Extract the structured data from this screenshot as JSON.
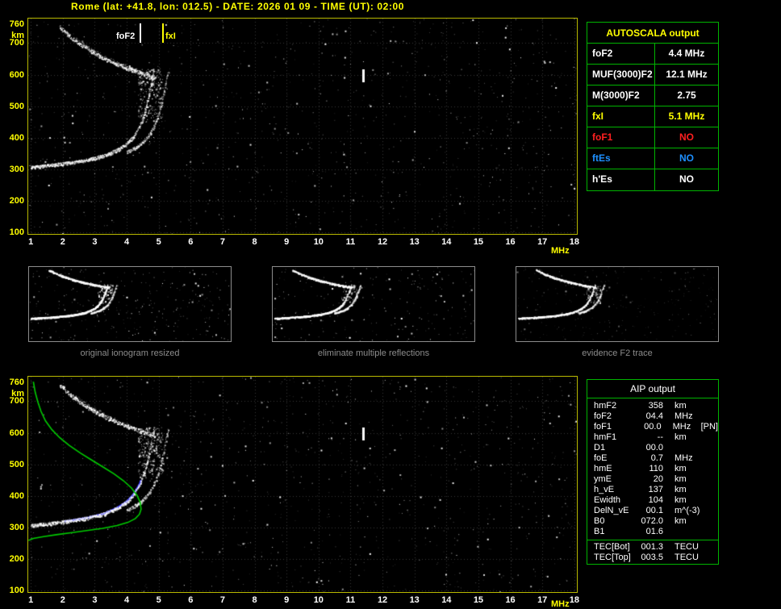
{
  "colors": {
    "yellow": "#ffff00",
    "plot_border": "#b8b800",
    "green": "#00b400",
    "red": "#ff2020",
    "blue": "#1e90ff",
    "white": "#ffffff",
    "gray": "#8c8c8c",
    "profile_green": "#00cc00",
    "trace_blue": "#3333ff"
  },
  "header": {
    "title": "Rome (lat: +41.8, lon: 012.5) - DATE: 2026 01 09 - TIME (UT): 02:00"
  },
  "axis": {
    "y_unit": "km",
    "x_unit": "MHz",
    "y_ticks": [
      760,
      700,
      600,
      500,
      400,
      300,
      200,
      100
    ],
    "x_ticks": [
      1,
      2,
      3,
      4,
      5,
      6,
      7,
      8,
      9,
      10,
      11,
      12,
      13,
      14,
      15,
      16,
      17,
      18
    ]
  },
  "top_plot": {
    "fof2_label": "foF2",
    "fxi_label": "fxI"
  },
  "autoscala": {
    "title": "AUTOSCALA output",
    "rows": [
      {
        "param": "foF2",
        "value": "4.4 MHz",
        "color": "#ffffff"
      },
      {
        "param": "MUF(3000)F2",
        "value": "12.1 MHz",
        "color": "#ffffff"
      },
      {
        "param": "M(3000)F2",
        "value": "2.75",
        "color": "#ffffff"
      },
      {
        "param": "fxI",
        "value": "5.1 MHz",
        "color": "#ffff00"
      },
      {
        "param": "foF1",
        "value": "NO",
        "color": "#ff2020"
      },
      {
        "param": "ftEs",
        "value": "NO",
        "color": "#1e90ff"
      },
      {
        "param": "h'Es",
        "value": "NO",
        "color": "#ffffff"
      }
    ]
  },
  "thumbnails": [
    {
      "caption": "original ionogram resized"
    },
    {
      "caption": "eliminate multiple reflections"
    },
    {
      "caption": "evidence F2 trace"
    }
  ],
  "aip": {
    "title": "AIP output",
    "rows": [
      {
        "param": "hmF2",
        "value": "358",
        "unit": "km",
        "note": ""
      },
      {
        "param": "foF2",
        "value": "04.4",
        "unit": "MHz",
        "note": ""
      },
      {
        "param": "foF1",
        "value": "00.0",
        "unit": "MHz",
        "note": "[PN]"
      },
      {
        "param": "hmF1",
        "value": "--",
        "unit": "km",
        "note": ""
      },
      {
        "param": "D1",
        "value": "00.0",
        "unit": "",
        "note": ""
      },
      {
        "param": "foE",
        "value": "0.7",
        "unit": "MHz",
        "note": ""
      },
      {
        "param": "hmE",
        "value": "110",
        "unit": "km",
        "note": ""
      },
      {
        "param": "ymE",
        "value": "20",
        "unit": "km",
        "note": ""
      },
      {
        "param": "h_vE",
        "value": "137",
        "unit": "km",
        "note": ""
      },
      {
        "param": "Ewidth",
        "value": "104",
        "unit": "km",
        "note": ""
      },
      {
        "param": "DelN_vE",
        "value": "00.1",
        "unit": "m^(-3)",
        "note": ""
      },
      {
        "param": "B0",
        "value": "072.0",
        "unit": "km",
        "note": ""
      },
      {
        "param": "B1",
        "value": "01.6",
        "unit": "",
        "note": ""
      }
    ],
    "tec_rows": [
      {
        "param": "TEC[Bot]",
        "value": "001.3",
        "unit": "TECU",
        "note": ""
      },
      {
        "param": "TEC[Top]",
        "value": "003.5",
        "unit": "TECU",
        "note": ""
      }
    ]
  },
  "ionogram_data": {
    "f_range_mhz": [
      0.92,
      18.08
    ],
    "h_range_km": [
      95,
      778
    ],
    "f2_trace": [
      [
        1.0,
        307
      ],
      [
        1.6,
        313
      ],
      [
        2.2,
        321
      ],
      [
        2.8,
        331
      ],
      [
        3.3,
        344
      ],
      [
        3.7,
        362
      ],
      [
        4.0,
        382
      ],
      [
        4.2,
        403
      ],
      [
        4.4,
        436
      ],
      [
        4.55,
        478
      ],
      [
        4.65,
        518
      ],
      [
        4.73,
        556
      ],
      [
        4.79,
        588
      ],
      [
        4.84,
        614
      ]
    ],
    "second_hop": [
      [
        1.9,
        752
      ],
      [
        2.2,
        724
      ],
      [
        2.5,
        700
      ],
      [
        2.9,
        674
      ],
      [
        3.3,
        652
      ],
      [
        3.7,
        634
      ],
      [
        4.1,
        618
      ],
      [
        4.45,
        605
      ],
      [
        4.7,
        597
      ],
      [
        4.88,
        592
      ]
    ],
    "x_mode_shift_mhz": 0.45,
    "spread_box": {
      "f": [
        4.35,
        5.12
      ],
      "h": [
        445,
        618
      ]
    },
    "artifact": {
      "f": 11.36,
      "h": [
        574,
        616
      ]
    },
    "profile": [
      [
        1.08,
        762
      ],
      [
        1.14,
        728
      ],
      [
        1.22,
        698
      ],
      [
        1.32,
        668
      ],
      [
        1.46,
        638
      ],
      [
        1.66,
        610
      ],
      [
        1.9,
        585
      ],
      [
        2.2,
        560
      ],
      [
        2.55,
        536
      ],
      [
        2.9,
        514
      ],
      [
        3.25,
        492
      ],
      [
        3.6,
        470
      ],
      [
        3.9,
        448
      ],
      [
        4.15,
        425
      ],
      [
        4.32,
        402
      ],
      [
        4.42,
        380
      ],
      [
        4.45,
        358
      ],
      [
        4.4,
        342
      ],
      [
        4.27,
        328
      ],
      [
        4.04,
        316
      ],
      [
        3.7,
        306
      ],
      [
        3.25,
        297
      ],
      [
        2.75,
        290
      ],
      [
        2.25,
        283
      ],
      [
        1.8,
        277
      ],
      [
        1.4,
        271
      ],
      [
        1.08,
        265
      ],
      [
        0.93,
        259
      ]
    ],
    "blue_overlay_f": [
      2.05,
      4.45
    ]
  }
}
